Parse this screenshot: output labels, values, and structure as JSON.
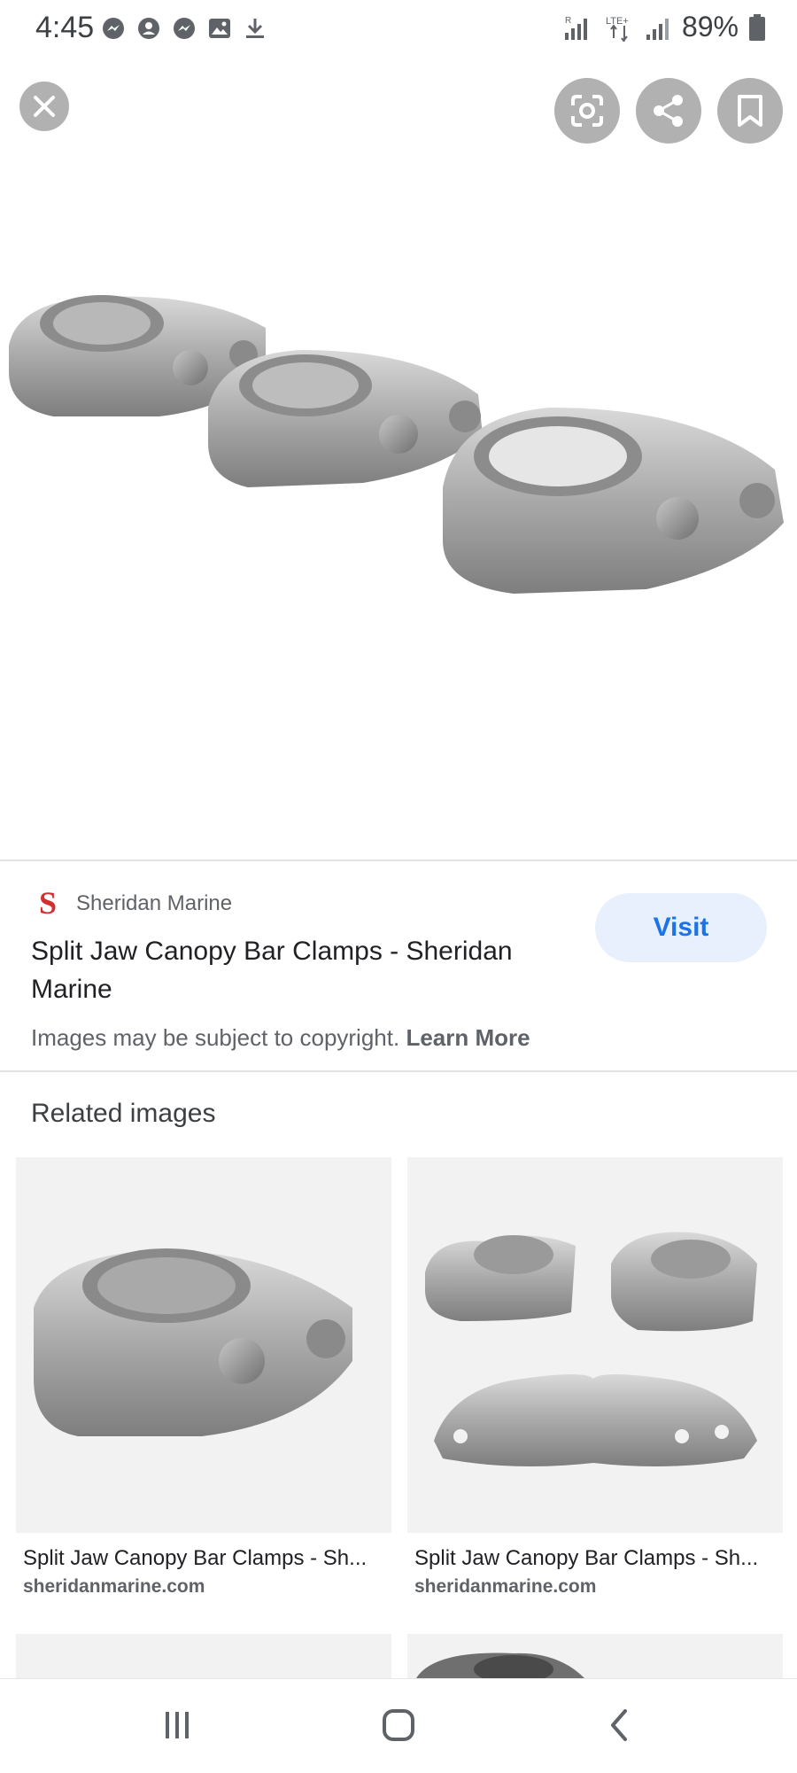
{
  "status_bar": {
    "time": "4:45",
    "battery": "89%",
    "network": "LTE+"
  },
  "source": {
    "name": "Sheridan Marine",
    "logo_letter": "S",
    "title": "Split Jaw Canopy Bar Clamps - Sheridan Marine",
    "visit_label": "Visit"
  },
  "copyright": {
    "text": "Images may be subject to copyright.",
    "link": "Learn More"
  },
  "related": {
    "title": "Related images",
    "items": [
      {
        "caption": "Split Jaw Canopy Bar Clamps - Sh...",
        "domain": "sheridanmarine.com"
      },
      {
        "caption": "Split Jaw Canopy Bar Clamps - Sh...",
        "domain": "sheridanmarine.com"
      }
    ]
  },
  "colors": {
    "accent": "#1a73e8",
    "visit_bg": "#e8f0fe",
    "overlay_button": "#b1b1b1",
    "logo": "#d32f2f"
  },
  "icons": [
    "close-icon",
    "lens-icon",
    "share-icon",
    "bookmark-icon",
    "recents-icon",
    "home-icon",
    "back-icon"
  ]
}
